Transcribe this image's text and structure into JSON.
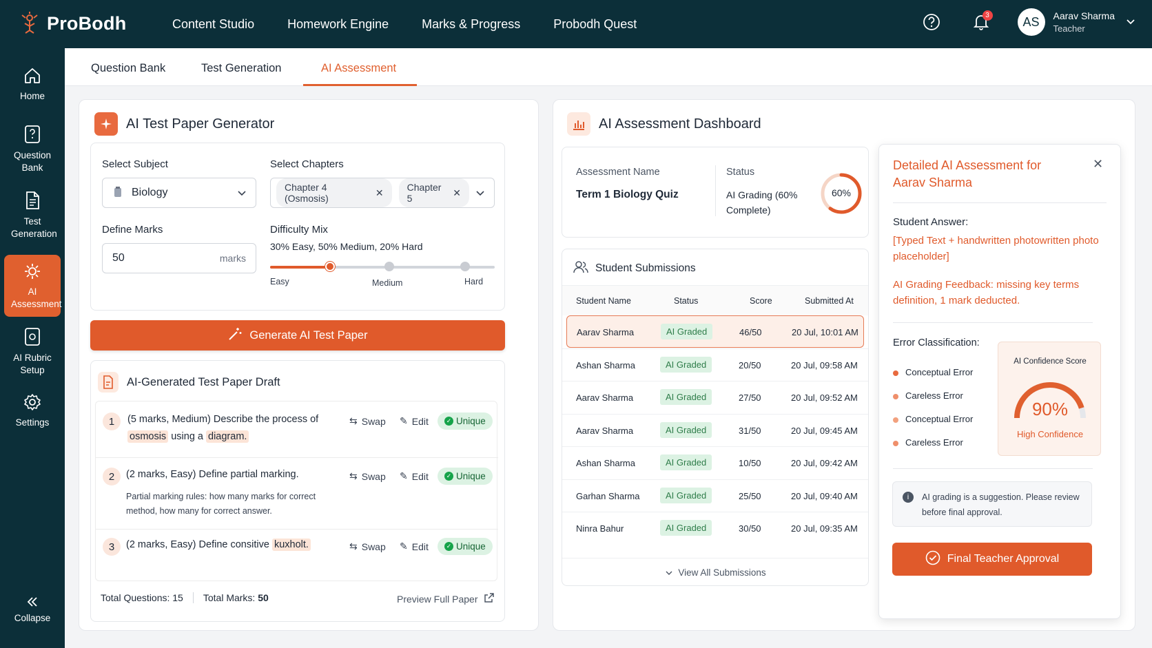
{
  "app": {
    "name": "ProBodh"
  },
  "topnav": [
    "Content Studio",
    "Homework Engine",
    "Marks & Progress",
    "Probodh Quest"
  ],
  "user": {
    "initials": "AS",
    "name": "Aarav Sharma",
    "role": "Teacher",
    "notifications": "3"
  },
  "sidebar": {
    "items": [
      {
        "label": "Home",
        "icon": "home-icon"
      },
      {
        "label": "Question Bank",
        "icon": "question-icon"
      },
      {
        "label": "Test Generation",
        "icon": "document-icon"
      },
      {
        "label": "AI Assessment",
        "icon": "ai-gear-icon",
        "active": true
      },
      {
        "label": "AI Rubric Setup",
        "icon": "rubric-icon"
      },
      {
        "label": "Settings",
        "icon": "gear-icon"
      }
    ],
    "collapse": "Collapse"
  },
  "tabs": [
    "Question Bank",
    "Test Generation",
    "AI Assessment"
  ],
  "generator": {
    "title": "AI Test Paper Generator",
    "subject_label": "Select Subject",
    "subject_value": "Biology",
    "chapters_label": "Select Chapters",
    "chapters": [
      "Chapter 4 (Osmosis)",
      "Chapter 5"
    ],
    "marks_label": "Define Marks",
    "marks_value": "50",
    "marks_unit": "marks",
    "difficulty_label": "Difficulty Mix",
    "difficulty_text": "30% Easy, 50% Medium, 20% Hard",
    "slider_labels": [
      "Easy",
      "Medium",
      "Hard"
    ],
    "generate_button": "Generate AI Test Paper"
  },
  "draft": {
    "title": "AI-Generated Test Paper Draft",
    "questions": [
      {
        "num": "1",
        "text_a": "(5 marks, Medium) Describe the process of",
        "hl1": "osmosis",
        "mid": "using a",
        "hl2": "diagram."
      },
      {
        "num": "2",
        "text": "(2 marks, Easy) Define partial marking.",
        "note": "Partial marking rules: how many marks for correct method, how many for correct answer."
      },
      {
        "num": "3",
        "text": "(2 marks, Easy) Define consitive",
        "hl": "kuxholt."
      }
    ],
    "swap": "Swap",
    "edit": "Edit",
    "unique": "Unique",
    "total_questions": "Total Questions: 15",
    "total_marks_label": "Total Marks:",
    "total_marks_value": "50",
    "preview": "Preview Full Paper"
  },
  "dashboard": {
    "title": "AI Assessment Dashboard",
    "assessment_name_label": "Assessment Name",
    "assessment_name": "Term 1 Biology Quiz",
    "status_label": "Status",
    "status_value": "AI Grading (60% Complete)",
    "progress_text": "60%",
    "progress": 0.6,
    "submissions_title": "Student Submissions",
    "columns": [
      "Student Name",
      "Status",
      "Score",
      "Submitted At"
    ],
    "rows": [
      {
        "name": "Aarav Sharma",
        "status": "AI Graded",
        "score": "46/50",
        "time": "20 Jul, 10:01 AM",
        "selected": true
      },
      {
        "name": "Ashan Sharma",
        "status": "AI Graded",
        "score": "20/50",
        "time": "20 Jul, 09:58 AM"
      },
      {
        "name": "Aarav Sharma",
        "status": "AI Graded",
        "score": "27/50",
        "time": "20 Jul, 09:52 AM"
      },
      {
        "name": "Aarav Sharma",
        "status": "AI Graded",
        "score": "31/50",
        "time": "20 Jul, 09:45 AM"
      },
      {
        "name": "Ashan Sharma",
        "status": "AI Graded",
        "score": "10/50",
        "time": "20 Jul, 09:42 AM"
      },
      {
        "name": "Garhan Sharma",
        "status": "AI Graded",
        "score": "25/50",
        "time": "20 Jul, 09:40 AM"
      },
      {
        "name": "Ninra  Bahur",
        "status": "AI Graded",
        "score": "30/50",
        "time": "20 Jul, 09:35 AM"
      }
    ],
    "view_all": "View All Submissions"
  },
  "detail": {
    "title": "Detailed AI Assessment for Aarav Sharma",
    "answer_label": "Student Answer:",
    "answer_text": "[Typed Text + handwritten photowritten photo placeholder]",
    "feedback_label": "AI Grading Feedback:",
    "feedback_text": "missing key terms definition, 1 mark deducted.",
    "error_label": "Error Classification:",
    "errors": [
      "Conceptual Error",
      "Careless Error",
      "Conceptual Error",
      "Careless Error"
    ],
    "confidence_label": "AI Confidence Score",
    "confidence_value": "90%",
    "confidence": 0.9,
    "confidence_text": "High Confidence",
    "notice": "AI grading is a suggestion. Please review before final approval.",
    "approve_button": "Final Teacher Approval"
  },
  "colors": {
    "accent": "#e05a2b",
    "navy": "#0c2f39",
    "green": "#dcf2e3"
  }
}
